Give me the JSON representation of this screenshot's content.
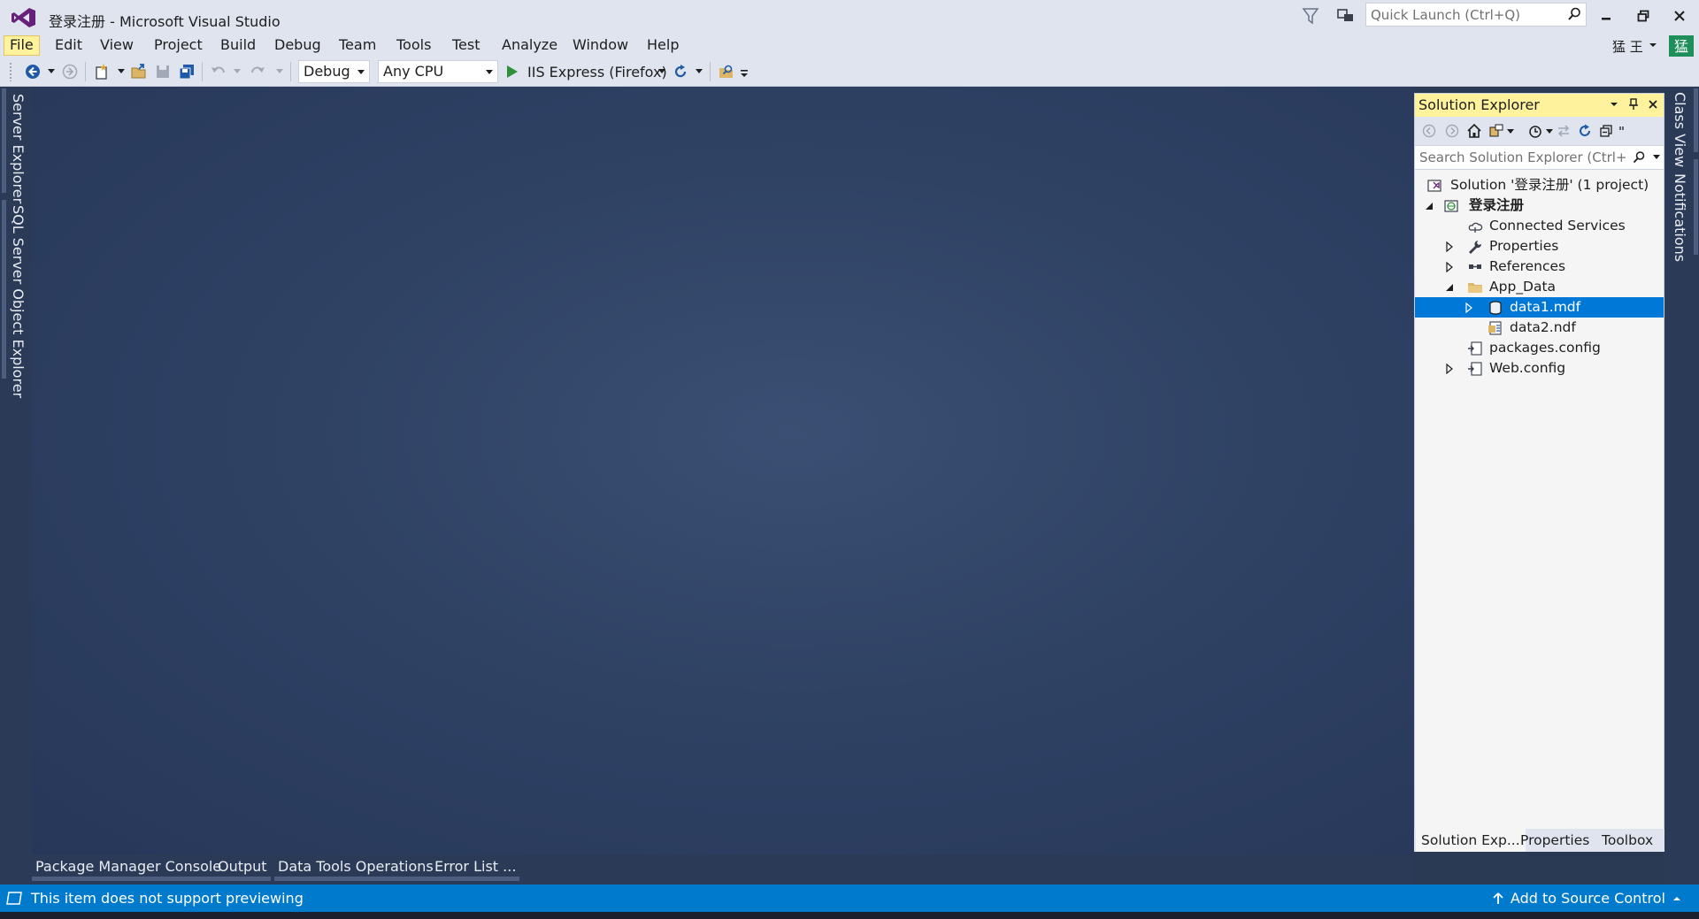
{
  "window": {
    "title": "登录注册 - Microsoft Visual Studio",
    "quick_launch_placeholder": "Quick Launch (Ctrl+Q)"
  },
  "user": {
    "name": "猛 王",
    "avatar_letter": "猛"
  },
  "menu": {
    "items": [
      "File",
      "Edit",
      "View",
      "Project",
      "Build",
      "Debug",
      "Team",
      "Tools",
      "Test",
      "Analyze",
      "Window",
      "Help"
    ],
    "active_index": 0
  },
  "toolbar": {
    "config_value": "Debug",
    "platform_value": "Any CPU",
    "run_label": "IIS Express (Firefox)"
  },
  "left_tabs": [
    "Server Explorer",
    "SQL Server Object Explorer"
  ],
  "right_tabs": [
    "Class View",
    "Notifications"
  ],
  "solution_explorer": {
    "title": "Solution Explorer",
    "search_placeholder": "Search Solution Explorer (Ctrl+;",
    "tree": [
      {
        "label": "Solution '登录注册' (1 project)",
        "icon": "solution-icon",
        "level": 0,
        "expander": "none"
      },
      {
        "label": "登录注册",
        "icon": "web-project-icon",
        "level": 0,
        "expander": "expanded",
        "bold": true
      },
      {
        "label": "Connected Services",
        "icon": "cloud-icon",
        "level": 1,
        "expander": "none"
      },
      {
        "label": "Properties",
        "icon": "wrench-icon",
        "level": 1,
        "expander": "collapsed"
      },
      {
        "label": "References",
        "icon": "references-icon",
        "level": 1,
        "expander": "collapsed"
      },
      {
        "label": "App_Data",
        "icon": "folder-icon",
        "level": 1,
        "expander": "expanded"
      },
      {
        "label": "data1.mdf",
        "icon": "database-icon",
        "level": 2,
        "expander": "collapsed",
        "selected": true
      },
      {
        "label": "data2.ndf",
        "icon": "data-file-icon",
        "level": 2,
        "expander": "none"
      },
      {
        "label": "packages.config",
        "icon": "config-icon",
        "level": 1,
        "expander": "none"
      },
      {
        "label": "Web.config",
        "icon": "config-icon",
        "level": 1,
        "expander": "collapsed"
      }
    ],
    "bottom_tabs": [
      "Solution Exp...",
      "Properties",
      "Toolbox"
    ],
    "active_tab_index": 0
  },
  "bottom_tabs": [
    "Package Manager Console",
    "Output",
    "Data Tools Operations",
    "Error List ..."
  ],
  "status": {
    "message": "This item does not support previewing",
    "source_control": "Add to Source Control"
  },
  "colors": {
    "accent": "#007acc",
    "selection": "#0078d7",
    "active_header": "#fff29d",
    "chrome": "#dfe4ee",
    "vs_purple": "#68217a",
    "avatar": "#1e8e5a"
  }
}
